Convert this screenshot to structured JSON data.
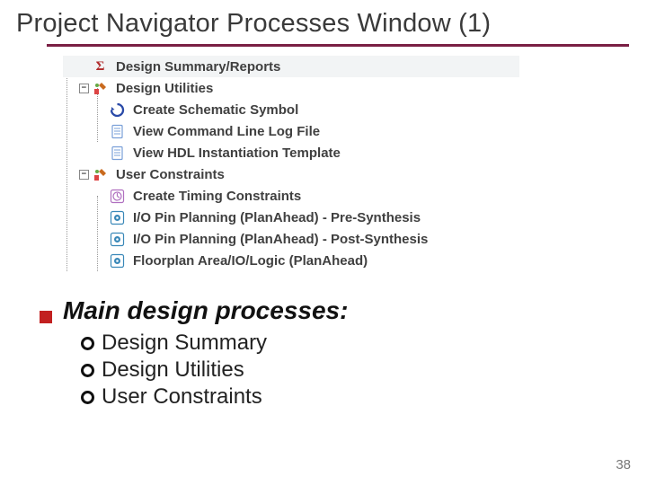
{
  "title": "Project Navigator Processes Window (1)",
  "tree": {
    "n0": {
      "label": "Design Summary/Reports"
    },
    "n1": {
      "label": "Design Utilities"
    },
    "n1_0": {
      "label": "Create Schematic Symbol"
    },
    "n1_1": {
      "label": "View Command Line Log File"
    },
    "n1_2": {
      "label": "View HDL Instantiation Template"
    },
    "n2": {
      "label": "User Constraints"
    },
    "n2_0": {
      "label": "Create Timing Constraints"
    },
    "n2_1": {
      "label": "I/O Pin Planning (PlanAhead) - Pre-Synthesis"
    },
    "n2_2": {
      "label": "I/O Pin Planning (PlanAhead) - Post-Synthesis"
    },
    "n2_3": {
      "label": "Floorplan Area/IO/Logic (PlanAhead)"
    }
  },
  "body": {
    "heading": "Main design processes:",
    "items": [
      "Design Summary",
      "Design Utilities",
      "User Constraints"
    ]
  },
  "page": "38"
}
